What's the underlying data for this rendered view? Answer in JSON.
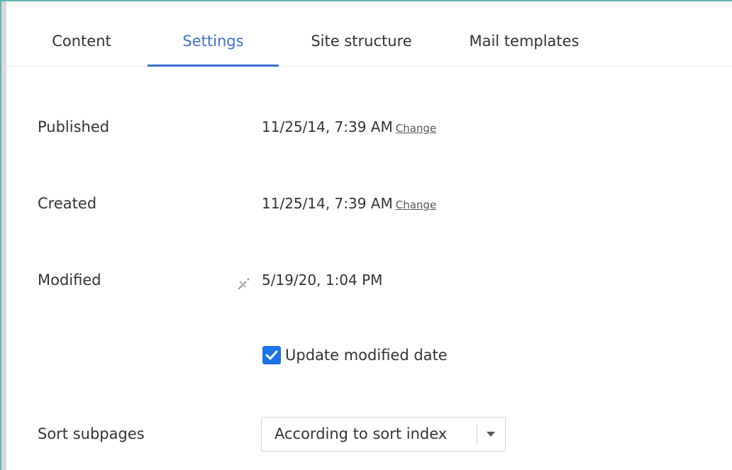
{
  "tabs": [
    {
      "label": "Content",
      "active": false
    },
    {
      "label": "Settings",
      "active": true
    },
    {
      "label": "Site structure",
      "active": false
    },
    {
      "label": "Mail templates",
      "active": false
    }
  ],
  "fields": {
    "published": {
      "label": "Published",
      "value": "11/25/14, 7:39 AM",
      "action": "Change"
    },
    "created": {
      "label": "Created",
      "value": "11/25/14, 7:39 AM",
      "action": "Change"
    },
    "modified": {
      "label": "Modified",
      "value": "5/19/20, 1:04 PM",
      "icon": "clear-date-icon"
    }
  },
  "update_modified": {
    "label": "Update modified date",
    "checked": true
  },
  "sort_subpages": {
    "label": "Sort subpages",
    "selected": "According to sort index",
    "icon": "chevron-down-icon"
  },
  "colors": {
    "accent": "#3d6fd6",
    "checkbox": "#1a73e8",
    "frame": "#5fb3b3"
  }
}
